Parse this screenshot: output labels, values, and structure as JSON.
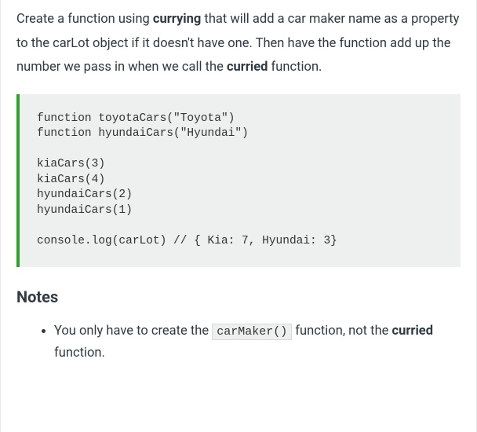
{
  "intro": {
    "t1": "Create a function using ",
    "b1": "currying",
    "t2": " that will add a car maker name as a property to the carLot object if it doesn't have one. Then have the function add up the number we pass in when we call the ",
    "b2": "curried",
    "t3": " function."
  },
  "code": "function toyotaCars(\"Toyota\")\nfunction hyundaiCars(\"Hyundai\")\n\nkiaCars(3)\nkiaCars(4)\nhyundaiCars(2)\nhyundaiCars(1)\n\nconsole.log(carLot) // { Kia: 7, Hyundai: 3}",
  "notes": {
    "heading": "Notes",
    "item1": {
      "t1": "You only have to create the ",
      "code": "carMaker()",
      "t2": " function, not the ",
      "b1": "curried",
      "t3": " function."
    }
  }
}
